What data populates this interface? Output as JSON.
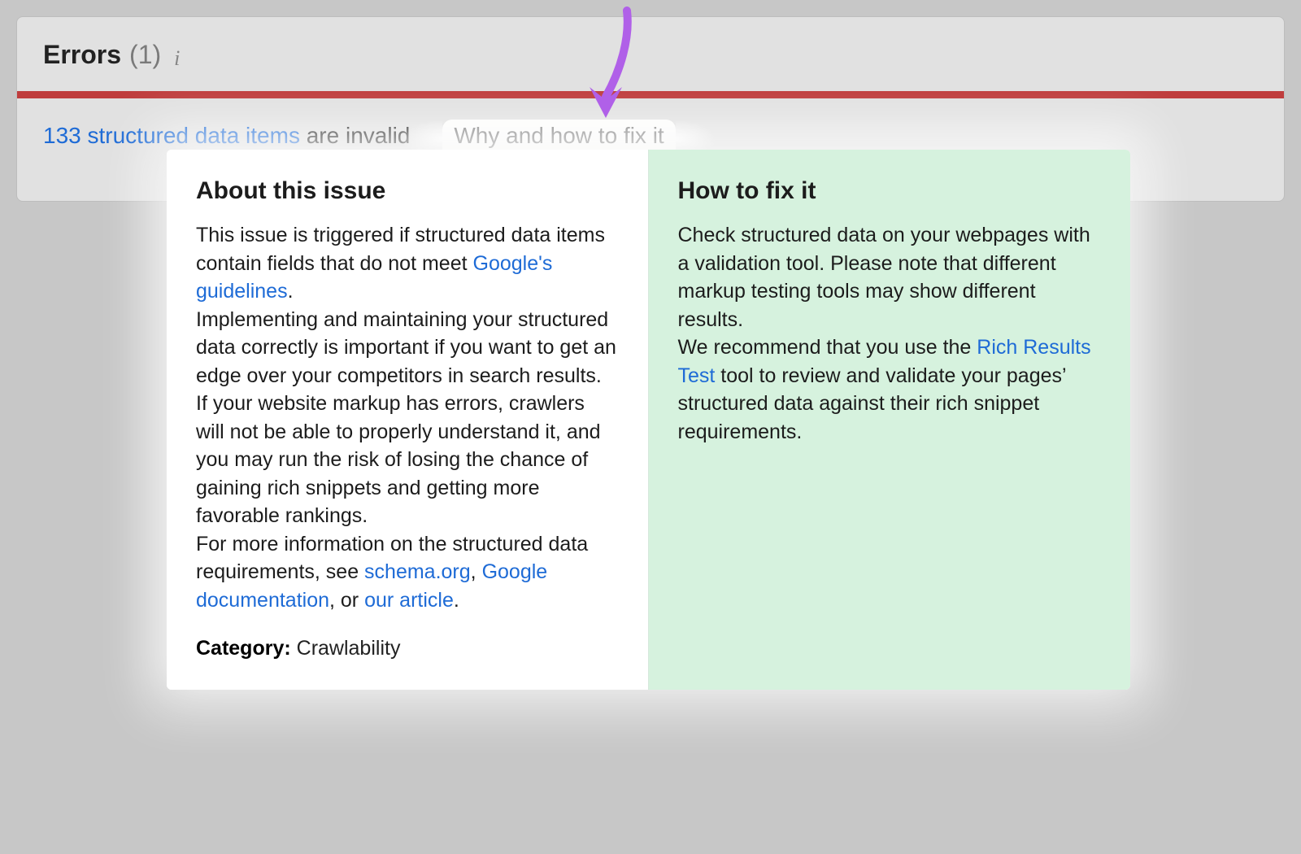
{
  "header": {
    "title": "Errors",
    "count_display": "(1)"
  },
  "issue_row": {
    "link_text": "133 structured data items",
    "suffix_text": "are invalid",
    "why_fix_label": "Why and how to fix it"
  },
  "popup": {
    "about": {
      "heading": "About this issue",
      "para1_pre": "This issue is triggered if structured data items contain fields that do not meet ",
      "google_guidelines_link": "Google's guidelines",
      "para1_post": ".",
      "para2": "Implementing and maintaining your structured data correctly is important if you want to get an edge over your competitors in search results.",
      "para3": "If your website markup has errors, crawlers will not be able to properly understand it, and you may run the risk of losing the chance of gaining rich snippets and getting more favorable rankings.",
      "para4_pre": "For more information on the structured data requirements, see ",
      "schema_link": "schema.org",
      "comma1": ", ",
      "googdoc_link": "Google documentation",
      "or_text": ", or ",
      "ourarticle_link": "our article",
      "para4_post": ".",
      "category_label": "Category:",
      "category_value": "Crawlability"
    },
    "fix": {
      "heading": "How to fix it",
      "para1": "Check structured data on your webpages with a validation tool. Please note that different markup testing tools may show different results.",
      "para2_pre": "We recommend that you use the ",
      "rrt_link": "Rich Results Test",
      "para2_post": " tool to review and validate your pages’ structured data against their rich snippet requirements."
    }
  }
}
